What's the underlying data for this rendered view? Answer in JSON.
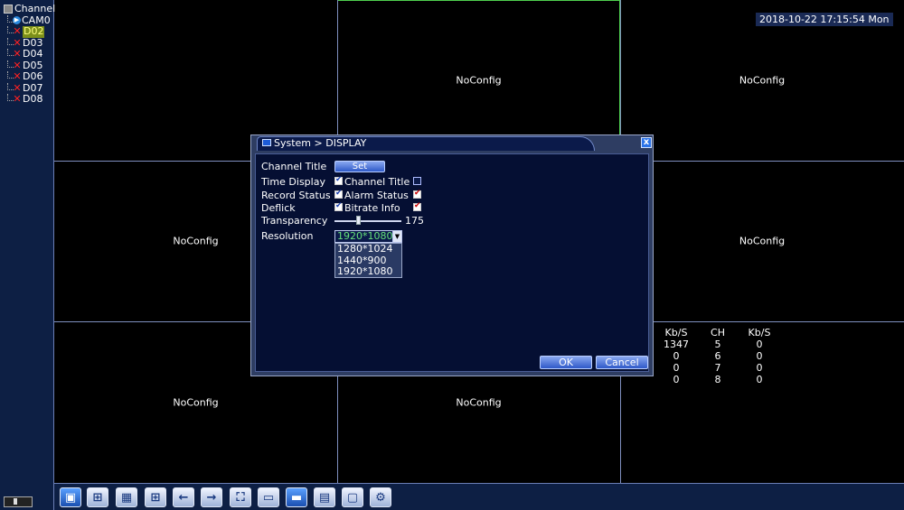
{
  "sidebar": {
    "root_label": "Channel",
    "channels": [
      {
        "label": "CAM0",
        "icon": "camera-connected-icon",
        "selected": false
      },
      {
        "label": "D02",
        "icon": "disconnected-x-icon",
        "selected": true
      },
      {
        "label": "D03",
        "icon": "disconnected-x-icon",
        "selected": false
      },
      {
        "label": "D04",
        "icon": "disconnected-x-icon",
        "selected": false
      },
      {
        "label": "D05",
        "icon": "disconnected-x-icon",
        "selected": false
      },
      {
        "label": "D06",
        "icon": "disconnected-x-icon",
        "selected": false
      },
      {
        "label": "D07",
        "icon": "disconnected-x-icon",
        "selected": false
      },
      {
        "label": "D08",
        "icon": "disconnected-x-icon",
        "selected": false
      }
    ]
  },
  "grid": {
    "cells": [
      "",
      "NoConfig",
      "NoConfig",
      "NoConfig",
      "",
      "NoConfig",
      "NoConfig",
      "NoConfig",
      ""
    ]
  },
  "datetime": "2018-10-22 17:15:54 Mon",
  "stats": {
    "headers": [
      "Kb/S",
      "CH",
      "Kb/S"
    ],
    "rows": [
      [
        "1347",
        "5",
        "0"
      ],
      [
        "0",
        "6",
        "0"
      ],
      [
        "0",
        "7",
        "0"
      ],
      [
        "0",
        "8",
        "0"
      ]
    ]
  },
  "dialog": {
    "title": "System > DISPLAY",
    "close_label": "x",
    "channel_title_label": "Channel Title",
    "set_label": "Set",
    "time_display_label": "Time Display",
    "channel_title_chk_label": "Channel Title",
    "record_status_label": "Record Status",
    "alarm_status_label": "Alarm Status",
    "deflick_label": "Deflick",
    "bitrate_info_label": "Bitrate Info",
    "transparency_label": "Transparency",
    "transparency_value": "175",
    "resolution_label": "Resolution",
    "resolution_value": "1920*1080",
    "resolution_options": [
      "1280*1024",
      "1440*900",
      "1920*1080"
    ],
    "ok_label": "OK",
    "cancel_label": "Cancel",
    "checks": {
      "time_display": true,
      "channel_title": false,
      "record_status": true,
      "alarm_status": true,
      "deflick": true,
      "bitrate_info": true
    }
  },
  "taskbar": {
    "buttons": [
      "single-view-icon",
      "quad-view-icon",
      "nine-view-icon",
      "sixteen-view-icon",
      "previous-arrow-icon",
      "next-arrow-icon",
      "fullscreen-icon",
      "monitor-icon",
      "display-icon",
      "playback-icon",
      "record-icon",
      "settings-icon"
    ]
  }
}
